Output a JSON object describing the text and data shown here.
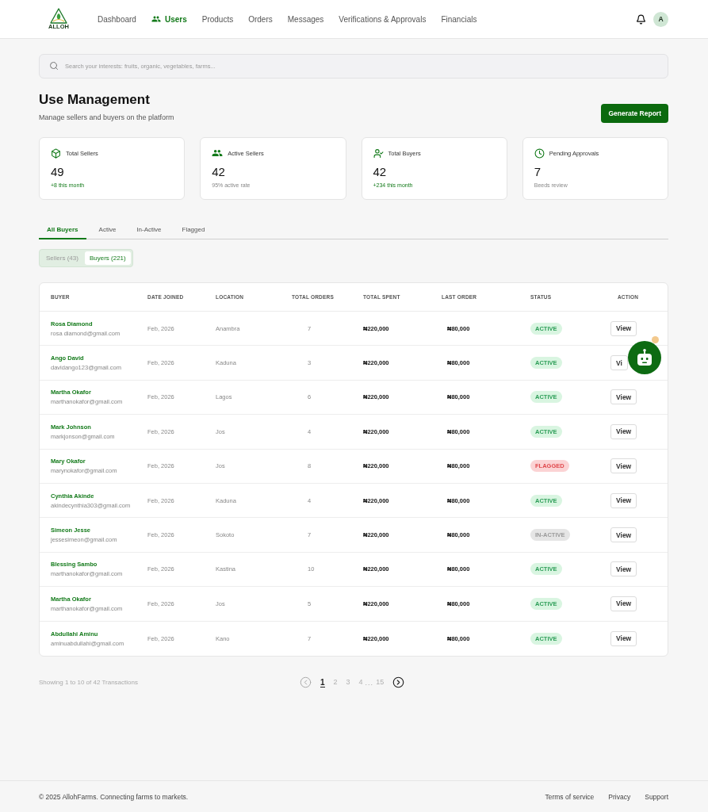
{
  "header": {
    "logo_text": "ALLOH",
    "nav": [
      {
        "label": "Dashboard",
        "selected": false
      },
      {
        "label": "Users",
        "selected": true
      },
      {
        "label": "Products",
        "selected": false
      },
      {
        "label": "Orders",
        "selected": false
      },
      {
        "label": "Messages",
        "selected": false
      },
      {
        "label": "Verifications & Approvals",
        "selected": false
      },
      {
        "label": "Financials",
        "selected": false
      }
    ],
    "avatar": "A"
  },
  "search": {
    "placeholder": "Search your interests: fruits, organic, vegetables, farms..."
  },
  "page": {
    "title": "Use Management",
    "subtitle": "Manage sellers and buyers on the platform",
    "action": "Generate Report"
  },
  "stats": [
    {
      "kind": "sellers",
      "label": "Total Sellers",
      "value": "49",
      "note": "+8 this month",
      "positive": true
    },
    {
      "kind": "active",
      "label": "Active Sellers",
      "value": "42",
      "note": "95% active rate",
      "positive": false
    },
    {
      "kind": "buyers",
      "label": "Total Buyers",
      "value": "42",
      "note": "+234 this month",
      "positive": true
    },
    {
      "kind": "pending",
      "label": "Pending Approvals",
      "value": "7",
      "note": "Beeds review",
      "positive": false
    }
  ],
  "tabs": [
    {
      "label": "All Buyers",
      "selected": true
    },
    {
      "label": "Active",
      "selected": false
    },
    {
      "label": "In-Active",
      "selected": false
    },
    {
      "label": "Flagged",
      "selected": false
    }
  ],
  "segments": [
    {
      "label": "Sellers (43)",
      "selected": false
    },
    {
      "label": "Buyers (221)",
      "selected": true
    }
  ],
  "table": {
    "columns": [
      "BUYER",
      "DATE JOINED",
      "LOCATION",
      "TOTAL ORDERS",
      "TOTAL SPENT",
      "LAST ORDER",
      "STATUS",
      "ACTION"
    ],
    "rows": [
      {
        "name": "Rosa Diamond",
        "email": "rosa diamond@gmail.com",
        "date_joined": "Feb, 2026",
        "location": "Anambra",
        "total_orders": "7",
        "total_spent": "₦220,000",
        "last_order": "₦80,000",
        "status": {
          "kind": "active",
          "label": "ACTIVE"
        },
        "action": "View"
      },
      {
        "name": "Ango David",
        "email": "davidango123@gmail.com",
        "date_joined": "Feb, 2026",
        "location": "Kaduna",
        "total_orders": "3",
        "total_spent": "₦220,000",
        "last_order": "₦80,000",
        "status": {
          "kind": "active",
          "label": "ACTIVE"
        },
        "action": "Vi"
      },
      {
        "name": "Martha Okafor",
        "email": "marthanokafor@gmail.com",
        "date_joined": "Feb, 2026",
        "location": "Lagos",
        "total_orders": "6",
        "total_spent": "₦220,000",
        "last_order": "₦80,000",
        "status": {
          "kind": "active",
          "label": "ACTIVE"
        },
        "action": "View"
      },
      {
        "name": "Mark Johnson",
        "email": "markjonson@gmail.com",
        "date_joined": "Feb, 2026",
        "location": "Jos",
        "total_orders": "4",
        "total_spent": "₦220,000",
        "last_order": "₦80,000",
        "status": {
          "kind": "active",
          "label": "ACTIVE"
        },
        "action": "View"
      },
      {
        "name": "Mary Okafor",
        "email": "marynokafor@gmail.com",
        "date_joined": "Feb, 2026",
        "location": "Jos",
        "total_orders": "8",
        "total_spent": "₦220,000",
        "last_order": "₦80,000",
        "status": {
          "kind": "flagged",
          "label": "FLAGGED"
        },
        "action": "View"
      },
      {
        "name": "Cynthia Akinde",
        "email": "akindecynthia303@gmail.com",
        "date_joined": "Feb, 2026",
        "location": "Kaduna",
        "total_orders": "4",
        "total_spent": "₦220,000",
        "last_order": "₦80,000",
        "status": {
          "kind": "active",
          "label": "ACTIVE"
        },
        "action": "View"
      },
      {
        "name": "Simeon Jesse",
        "email": "jessesimeon@gmail.com",
        "date_joined": "Feb, 2026",
        "location": "Sokoto",
        "total_orders": "7",
        "total_spent": "₦220,000",
        "last_order": "₦80,000",
        "status": {
          "kind": "inactive",
          "label": "IN-ACTIVE"
        },
        "action": "View"
      },
      {
        "name": "Blessing Sambo",
        "email": "marthanokafor@gmail.com",
        "date_joined": "Feb, 2026",
        "location": "Kastina",
        "total_orders": "10",
        "total_spent": "₦220,000",
        "last_order": "₦80,000",
        "status": {
          "kind": "active",
          "label": "ACTIVE"
        },
        "action": "View"
      },
      {
        "name": "Martha Okafor",
        "email": "marthanokafor@gmail.com",
        "date_joined": "Feb, 2026",
        "location": "Jos",
        "total_orders": "5",
        "total_spent": "₦220,000",
        "last_order": "₦80,000",
        "status": {
          "kind": "active",
          "label": "ACTIVE"
        },
        "action": "View"
      },
      {
        "name": "Abdullahi Aminu",
        "email": "aminuabdullahi@gmail.com",
        "date_joined": "Feb, 2026",
        "location": "Kano",
        "total_orders": "7",
        "total_spent": "₦220,000",
        "last_order": "₦80,000",
        "status": {
          "kind": "active",
          "label": "ACTIVE"
        },
        "action": "View"
      }
    ]
  },
  "pagination": {
    "summary": "Showing 1 to 10 of 42 Transactions",
    "previous_disabled": true,
    "next_disabled": false,
    "pages": [
      {
        "kind": "page",
        "label": "1",
        "selected": true
      },
      {
        "kind": "page",
        "label": "2",
        "selected": false
      },
      {
        "kind": "page",
        "label": "3",
        "selected": false
      },
      {
        "kind": "page",
        "label": "4",
        "selected": false
      },
      {
        "kind": "gap",
        "label": "..."
      },
      {
        "kind": "page",
        "label": "15",
        "selected": false
      }
    ]
  },
  "chat": {
    "notification": true
  },
  "footer": {
    "copyright": "© 2025 AllohFarms. Connecting farms to markets.",
    "links": [
      "Terms of service",
      "Privacy",
      "Support"
    ]
  }
}
